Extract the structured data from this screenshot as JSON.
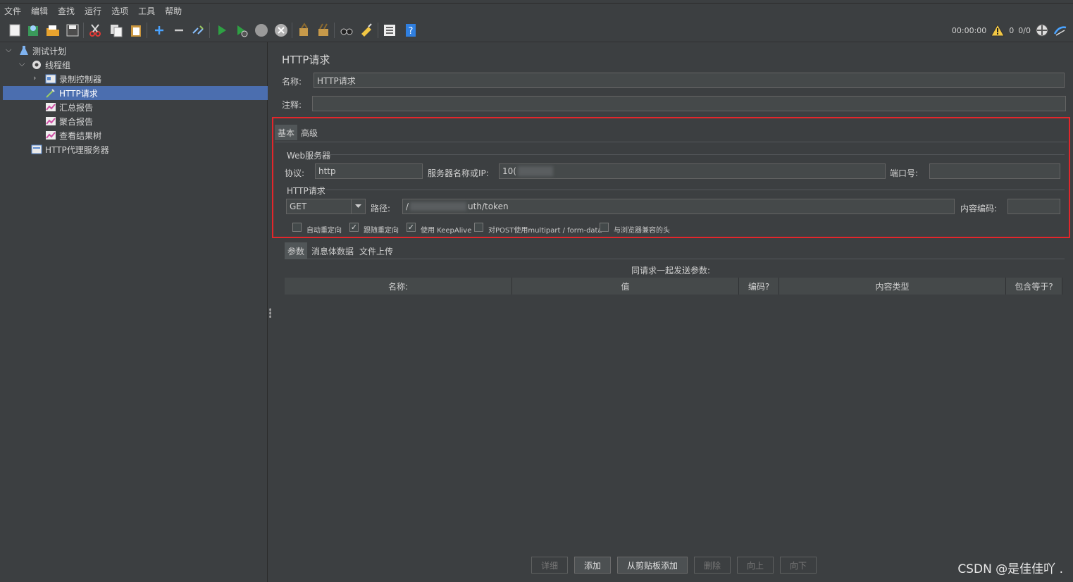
{
  "menu": [
    "文件",
    "编辑",
    "查找",
    "运行",
    "选项",
    "工具",
    "帮助"
  ],
  "toolbar_icons": [
    "new-icon",
    "templates-icon",
    "open-icon",
    "save-icon",
    "cut-icon",
    "copy-icon",
    "paste-icon",
    "expand-icon",
    "collapse-icon",
    "toggle-icon",
    "start-icon",
    "start-no-pause-icon",
    "stop-icon",
    "shutdown-icon",
    "clear-icon",
    "clear-all-icon",
    "search-icon",
    "reset-search-icon",
    "function-helper-icon",
    "help-icon"
  ],
  "status": {
    "timer": "00:00:00",
    "warnings": "0",
    "threads": "0/0"
  },
  "tree": {
    "items": [
      {
        "label": "测试计划",
        "icon": "flask-icon"
      },
      {
        "label": "线程组",
        "icon": "gear-icon"
      },
      {
        "label": "录制控制器",
        "icon": "controller-icon"
      },
      {
        "label": "HTTP请求",
        "icon": "pipette-icon"
      },
      {
        "label": "汇总报告",
        "icon": "chart-icon"
      },
      {
        "label": "聚合报告",
        "icon": "chart-icon"
      },
      {
        "label": "查看结果树",
        "icon": "chart-icon"
      },
      {
        "label": "HTTP代理服务器",
        "icon": "controller-icon"
      }
    ]
  },
  "panel": {
    "title": "HTTP请求",
    "name_label": "名称:",
    "name_value": "HTTP请求",
    "comment_label": "注释:",
    "comment_value": "",
    "tabs": [
      "基本",
      "高级"
    ],
    "web_server_group": "Web服务器",
    "protocol_label": "协议:",
    "protocol_value": "http",
    "server_label": "服务器名称或IP:",
    "server_value": "10(",
    "port_label": "端口号:",
    "port_value": "",
    "http_request_group": "HTTP请求",
    "method": "GET",
    "path_label": "路径:",
    "path_prefix": "/",
    "path_suffix": "uth/token",
    "encoding_label": "内容编码:",
    "encoding_value": "",
    "checkboxes": [
      {
        "label": "自动重定向",
        "checked": false
      },
      {
        "label": "跟随重定向",
        "checked": true
      },
      {
        "label": "使用 KeepAlive",
        "checked": true
      },
      {
        "label": "对POST使用multipart / form-data",
        "checked": false
      },
      {
        "label": "与浏览器兼容的头",
        "checked": false
      }
    ],
    "sub_tabs": [
      "参数",
      "消息体数据",
      "文件上传"
    ],
    "params_caption": "同请求一起发送参数:",
    "columns": [
      "名称:",
      "值",
      "编码?",
      "内容类型",
      "包含等于?"
    ],
    "buttons": [
      {
        "label": "详细",
        "enabled": false
      },
      {
        "label": "添加",
        "enabled": true
      },
      {
        "label": "从剪贴板添加",
        "enabled": true
      },
      {
        "label": "删除",
        "enabled": false
      },
      {
        "label": "向上",
        "enabled": false
      },
      {
        "label": "向下",
        "enabled": false
      }
    ]
  },
  "watermark": "CSDN @是佳佳吖 ."
}
